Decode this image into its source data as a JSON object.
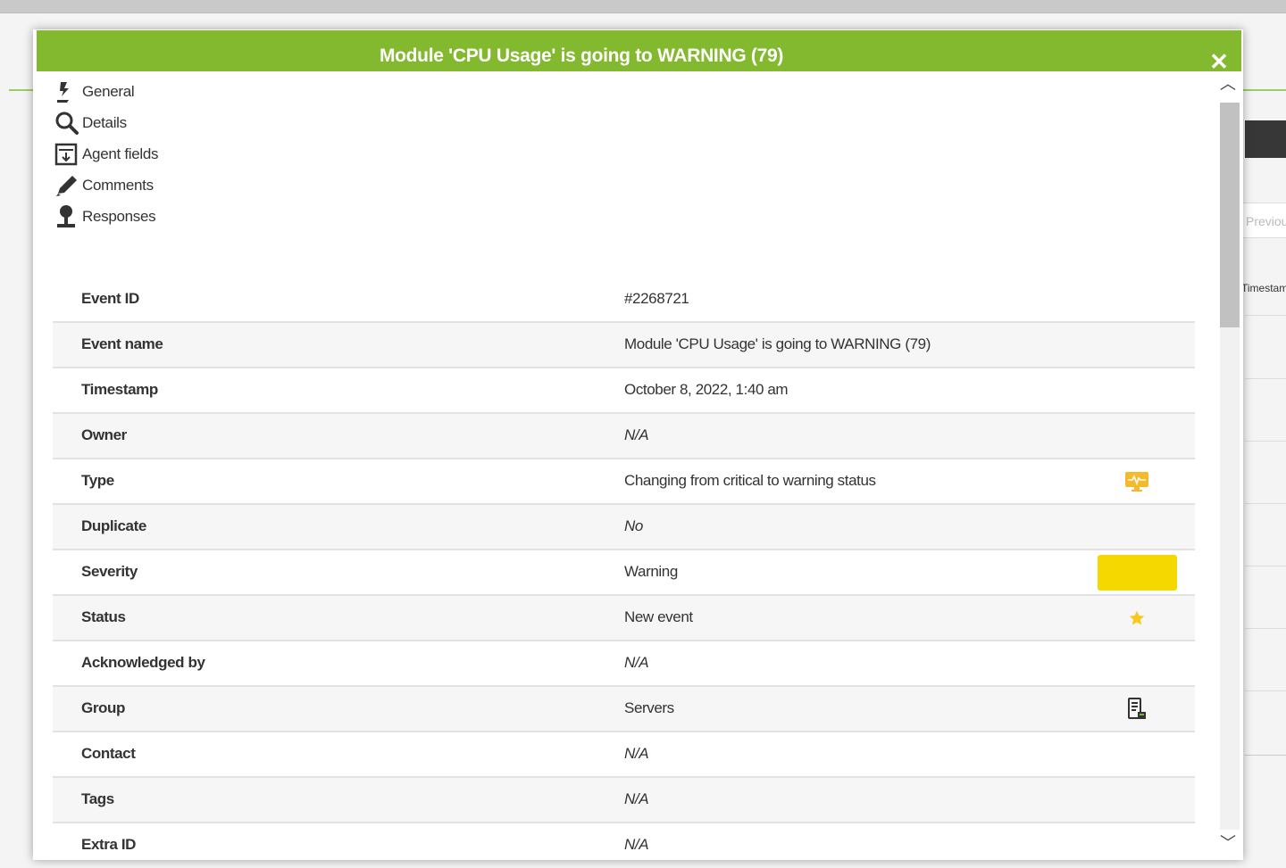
{
  "background": {
    "field_text": "Previous",
    "column_header": "Timestamp"
  },
  "modal": {
    "title": "Module 'CPU Usage' is going to WARNING (79)",
    "close_icon": "close-icon",
    "colors": {
      "titlebar": "#82b92e"
    }
  },
  "tabs": [
    {
      "label": "General",
      "icon": "general-icon"
    },
    {
      "label": "Details",
      "icon": "magnifier-icon"
    },
    {
      "label": "Agent fields",
      "icon": "agent-fields-icon"
    },
    {
      "label": "Comments",
      "icon": "pencil-icon"
    },
    {
      "label": "Responses",
      "icon": "responses-icon"
    }
  ],
  "event_rows": [
    {
      "label": "Event ID",
      "value": "#2268721"
    },
    {
      "label": "Event name",
      "value": "Module 'CPU Usage' is going to WARNING (79)"
    },
    {
      "label": "Timestamp",
      "value": "October 8, 2022, 1:40 am"
    },
    {
      "label": "Owner",
      "value": "N/A"
    },
    {
      "label": "Type",
      "value": "Changing from critical to warning status",
      "icon": "warning-status-icon"
    },
    {
      "label": "Duplicate",
      "value": "No"
    },
    {
      "label": "Severity",
      "value": "Warning",
      "color": "#f5d800"
    },
    {
      "label": "Status",
      "value": "New event",
      "icon": "star-icon"
    },
    {
      "label": "Acknowledged by",
      "value": "N/A"
    },
    {
      "label": "Group",
      "value": "Servers",
      "icon": "servers-group-icon"
    },
    {
      "label": "Contact",
      "value": "N/A"
    },
    {
      "label": "Tags",
      "value": "N/A"
    },
    {
      "label": "Extra ID",
      "value": "N/A"
    }
  ],
  "scrollbar": {
    "up_icon": "chevron-up-icon",
    "down_icon": "chevron-down-icon"
  }
}
